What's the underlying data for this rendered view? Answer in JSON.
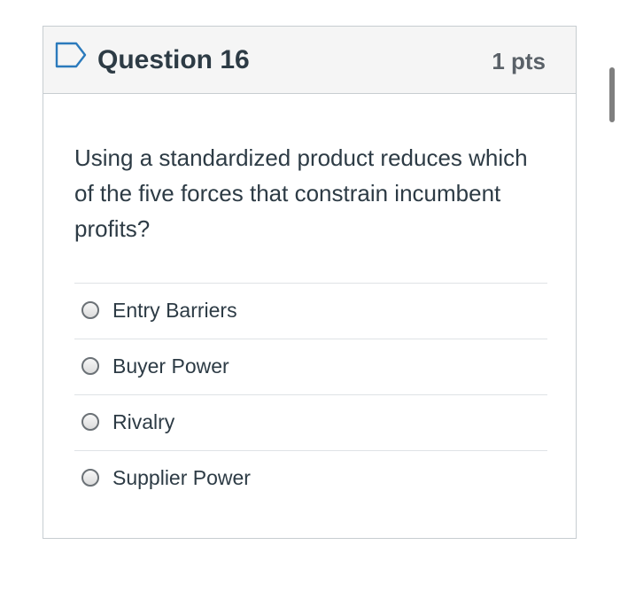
{
  "question": {
    "title": "Question 16",
    "points": "1 pts",
    "text": "Using a standardized product reduces which of the five forces that constrain incumbent profits?",
    "flag_icon": "flag-outline-icon",
    "accent_color": "#2b7abc"
  },
  "answers": [
    {
      "label": "Entry Barriers",
      "selected": false
    },
    {
      "label": "Buyer Power",
      "selected": false
    },
    {
      "label": "Rivalry",
      "selected": false
    },
    {
      "label": "Supplier Power",
      "selected": false
    }
  ]
}
